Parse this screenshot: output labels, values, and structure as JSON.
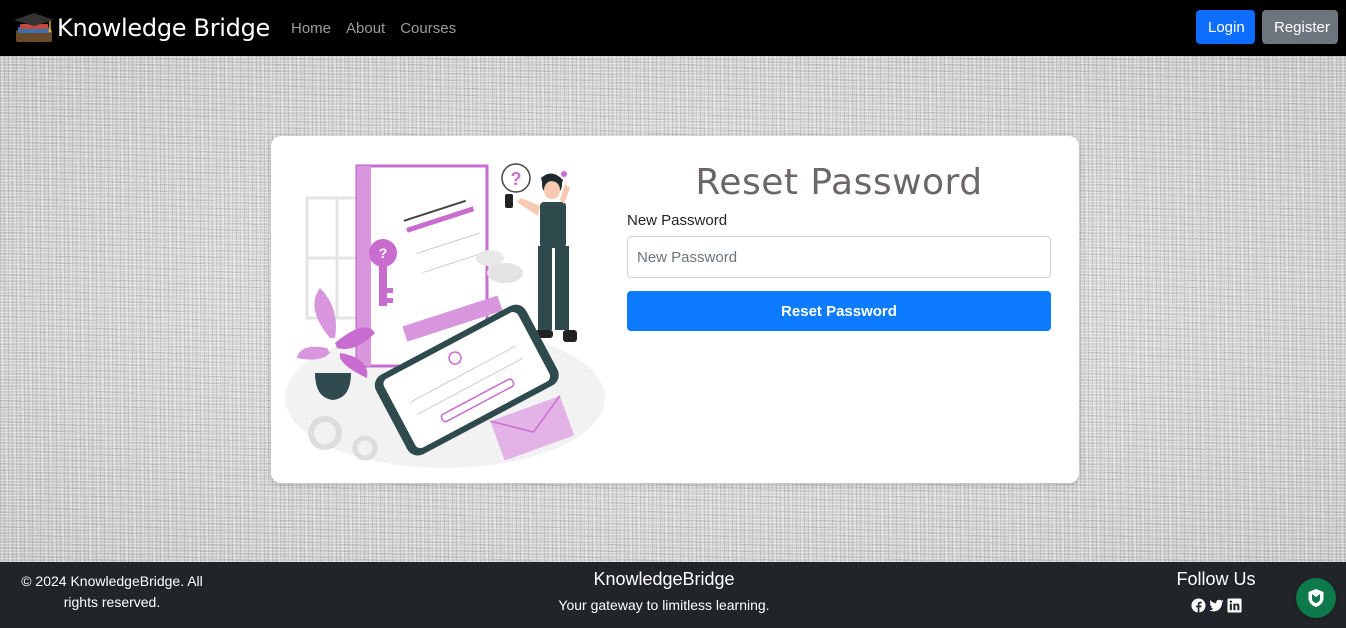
{
  "navbar": {
    "brand": "Knowledge Bridge",
    "links": [
      "Home",
      "About",
      "Courses"
    ],
    "login_label": "Login",
    "register_label": "Register"
  },
  "reset_form": {
    "title": "Reset Password",
    "field_label": "New Password",
    "field_placeholder": "New Password",
    "field_value": "",
    "submit_label": "Reset Password"
  },
  "footer": {
    "copyright": "© 2024 KnowledgeBridge. All rights reserved.",
    "brand": "KnowledgeBridge",
    "tagline": "Your gateway to limitless learning.",
    "follow_title": "Follow Us",
    "social_icons": [
      "facebook-icon",
      "twitter-icon",
      "linkedin-icon"
    ]
  },
  "colors": {
    "primary": "#0d6efd",
    "secondary": "#6c757d",
    "navbar_bg": "#000000",
    "footer_bg": "#212529",
    "title_color": "#6c6766",
    "shield_bg": "#0e7a4b"
  }
}
